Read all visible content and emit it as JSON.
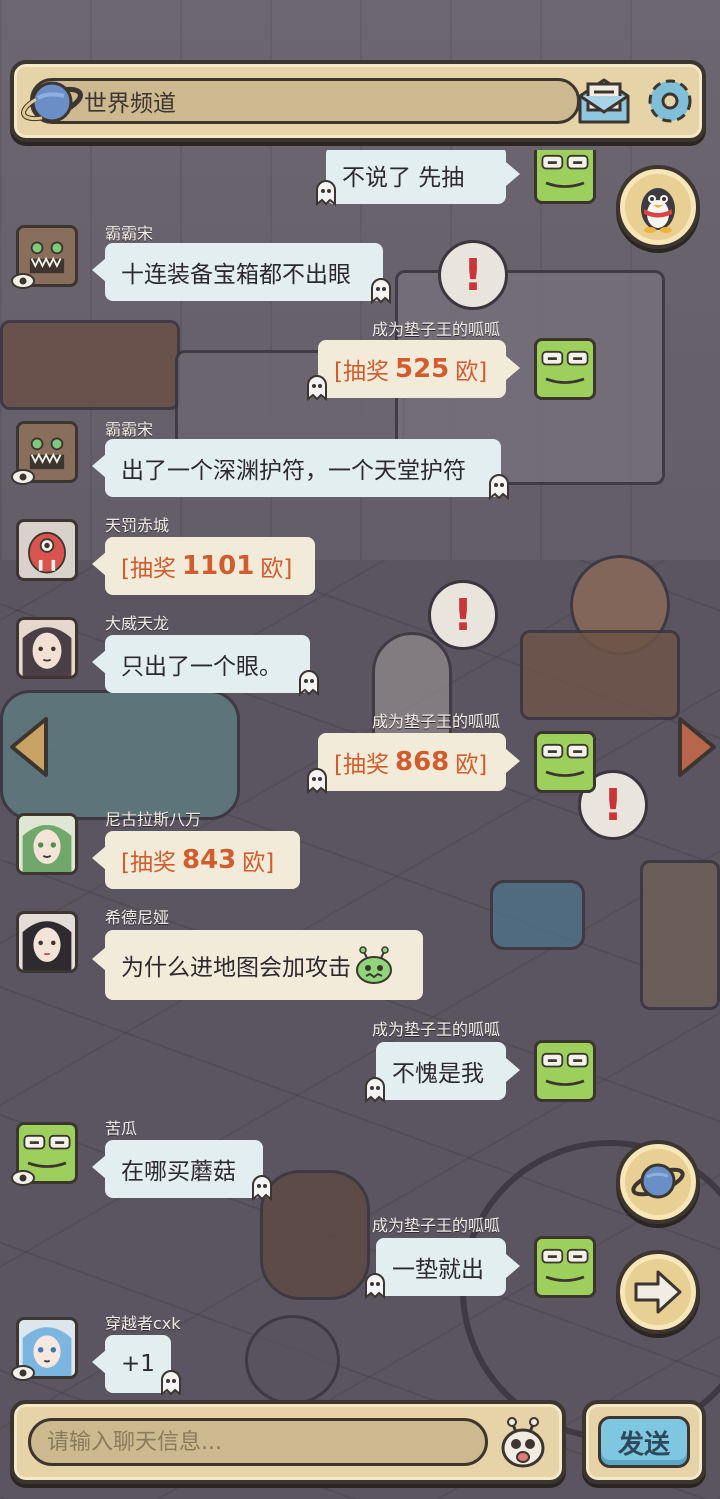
{
  "header": {
    "channel_title": "世界频道"
  },
  "messages": [
    {
      "side": "right",
      "user": "",
      "avatar": "frog",
      "type": "text",
      "text": "不说了    先抽"
    },
    {
      "side": "left",
      "user": "霸霸宋",
      "avatar": "monster",
      "type": "text",
      "text": "十连装备宝箱都不出眼"
    },
    {
      "side": "right",
      "user": "成为垫子王的呱呱",
      "avatar": "frog",
      "type": "lottery",
      "prefix": "[抽奖",
      "amount": "525",
      "suffix": "欧]"
    },
    {
      "side": "left",
      "user": "霸霸宋",
      "avatar": "monster",
      "type": "text",
      "text": "出了一个深渊护符，一个天堂护符"
    },
    {
      "side": "left",
      "user": "天罚赤城",
      "avatar": "red-beast",
      "type": "lottery",
      "prefix": "[抽奖",
      "amount": "1101",
      "suffix": "欧]"
    },
    {
      "side": "left",
      "user": "大威天龙",
      "avatar": "girl-dark",
      "type": "text",
      "text": "只出了一个眼。"
    },
    {
      "side": "right",
      "user": "成为垫子王的呱呱",
      "avatar": "frog",
      "type": "lottery",
      "prefix": "[抽奖",
      "amount": "868",
      "suffix": "欧]"
    },
    {
      "side": "left",
      "user": "尼古拉斯八万",
      "avatar": "girl-green",
      "type": "lottery",
      "prefix": "[抽奖",
      "amount": "843",
      "suffix": "欧]"
    },
    {
      "side": "left",
      "user": "希德尼娅",
      "avatar": "girl-black",
      "type": "text",
      "text": "为什么进地图会加攻击"
    },
    {
      "side": "right",
      "user": "成为垫子王的呱呱",
      "avatar": "frog",
      "type": "text",
      "text": "不愧是我"
    },
    {
      "side": "left",
      "user": "苦瓜",
      "avatar": "frog",
      "type": "text",
      "text": "在哪买蘑菇"
    },
    {
      "side": "right",
      "user": "成为垫子王的呱呱",
      "avatar": "frog",
      "type": "text",
      "text": "一垫就出"
    },
    {
      "side": "left",
      "user": "穿越者cxk",
      "avatar": "girl-blue",
      "type": "text",
      "text": "+1"
    }
  ],
  "input": {
    "placeholder": "请输入聊天信息..."
  },
  "send_label": "发送",
  "icons": {
    "channel": "planet-icon",
    "mail": "mail-icon",
    "settings": "gear-icon",
    "qq": "penguin-icon",
    "world": "planet-icon",
    "next": "arrow-right-icon",
    "emoji": "bug-emoji-icon"
  },
  "colors": {
    "panel": "#e6d3a8",
    "outline": "#3d3530",
    "bubble": "#e3eef0",
    "lottery_bubble": "#f3ebd9",
    "lottery_text": "#d05d2d",
    "send": "#7fc6e0"
  }
}
